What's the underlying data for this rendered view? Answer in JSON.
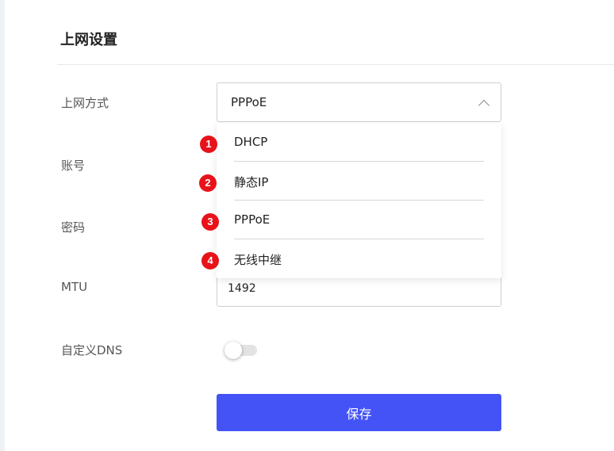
{
  "page": {
    "title": "上网设置"
  },
  "form": {
    "connection_type": {
      "label": "上网方式",
      "value": "PPPoE"
    },
    "account": {
      "label": "账号"
    },
    "password": {
      "label": "密码"
    },
    "mtu": {
      "label": "MTU",
      "value": "1492"
    },
    "custom_dns": {
      "label": "自定义DNS",
      "enabled": false
    },
    "save_label": "保存"
  },
  "dropdown": {
    "options": [
      {
        "badge": "1",
        "label": "DHCP"
      },
      {
        "badge": "2",
        "label": "静态IP"
      },
      {
        "badge": "3",
        "label": "PPPoE"
      },
      {
        "badge": "4",
        "label": "无线中继"
      }
    ]
  },
  "colors": {
    "primary": "#4353f5",
    "badge": "#e8121a"
  },
  "icons": {
    "select_chevron": "chevron-up-icon"
  }
}
